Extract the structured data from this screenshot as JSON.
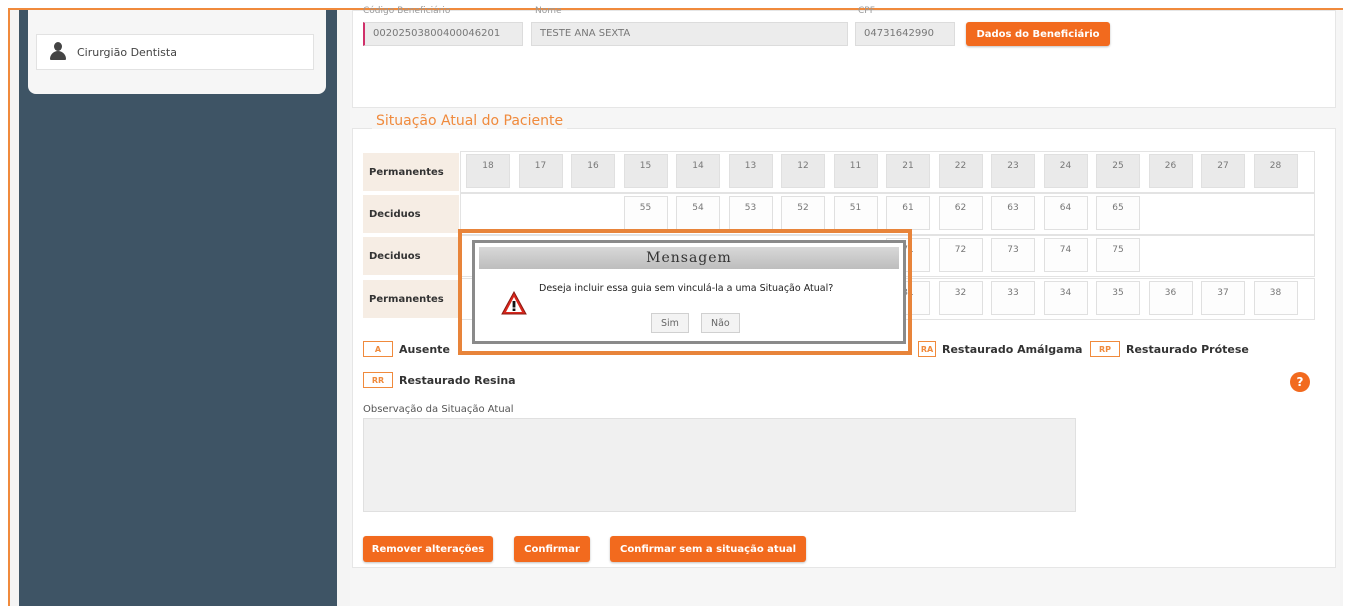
{
  "sidebar": {
    "item_label": "Cirurgião Dentista"
  },
  "beneficiary": {
    "code_label": "Código Beneficiário",
    "name_label": "Nome",
    "cpf_label": "CPF",
    "code": "00202503800400046201",
    "name": "TESTE ANA SEXTA",
    "cpf": "04731642990",
    "details_button": "Dados do Beneficiário"
  },
  "situation": {
    "title": "Situação Atual do Paciente",
    "rows": [
      {
        "label": "Permanentes",
        "teeth": [
          "18",
          "17",
          "16",
          "15",
          "14",
          "13",
          "12",
          "11",
          "21",
          "22",
          "23",
          "24",
          "25",
          "26",
          "27",
          "28"
        ]
      },
      {
        "label": "Deciduos",
        "teeth": [
          "55",
          "54",
          "53",
          "52",
          "51",
          "61",
          "62",
          "63",
          "64",
          "65"
        ]
      },
      {
        "label": "Deciduos",
        "teeth": [
          "71",
          "72",
          "73",
          "74",
          "75"
        ]
      },
      {
        "label": "Permanentes",
        "teeth": [
          "31",
          "32",
          "33",
          "34",
          "35",
          "36",
          "37",
          "38"
        ]
      }
    ],
    "legend": [
      {
        "code": "A",
        "label": "Ausente"
      },
      {
        "code": "RA",
        "label": "Restaurado Amálgama"
      },
      {
        "code": "RP",
        "label": "Restaurado Prótese"
      },
      {
        "code": "RR",
        "label": "Restaurado Resina"
      }
    ],
    "help_icon": "?",
    "observation_label": "Observação da Situação Atual"
  },
  "actions": {
    "remove": "Remover alterações",
    "confirm": "Confirmar",
    "confirm_without": "Confirmar sem a situação atual"
  },
  "dialog": {
    "title": "Mensagem",
    "message": "Deseja incluir essa guia sem vinculá-la a uma Situação Atual?",
    "yes": "Sim",
    "no": "Não"
  },
  "colors": {
    "accent": "#f26a1e",
    "sidebar": "#3e5465",
    "highlight": "#e8843a"
  }
}
